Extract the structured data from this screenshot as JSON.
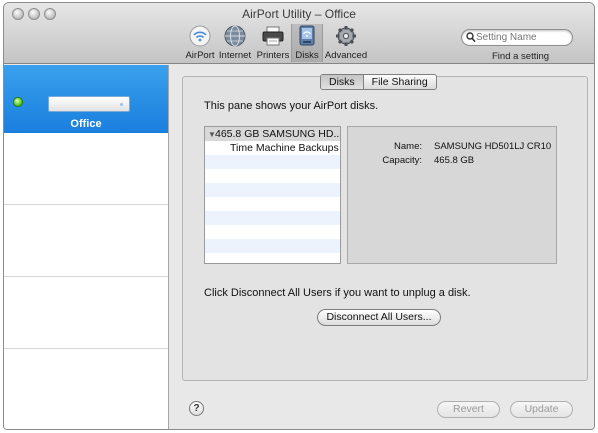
{
  "window": {
    "title": "AirPort Utility – Office"
  },
  "toolbar": {
    "items": [
      {
        "label": "AirPort",
        "icon": "airport-wifi-icon"
      },
      {
        "label": "Internet",
        "icon": "globe-icon"
      },
      {
        "label": "Printers",
        "icon": "printer-icon"
      },
      {
        "label": "Disks",
        "icon": "disk-icon",
        "selected": true
      },
      {
        "label": "Advanced",
        "icon": "gear-icon"
      }
    ],
    "search": {
      "placeholder": "Setting Name",
      "caption": "Find a setting"
    }
  },
  "sidebar": {
    "selected_base_station": {
      "name": "Office",
      "status_color": "#52c51d"
    }
  },
  "pane": {
    "tabs": [
      {
        "label": "Disks",
        "selected": true
      },
      {
        "label": "File Sharing",
        "selected": false
      }
    ],
    "intro_text": "This pane shows your AirPort disks.",
    "disk_list": {
      "disk": "465.8 GB SAMSUNG HD...",
      "partition": "Time Machine Backups"
    },
    "info": {
      "name_label": "Name:",
      "name_value": "SAMSUNG HD501LJ CR10",
      "capacity_label": "Capacity:",
      "capacity_value": "465.8 GB"
    },
    "hint_text": "Click Disconnect All Users if you want to unplug a disk.",
    "disconnect_button": "Disconnect All Users..."
  },
  "footer": {
    "help_label": "?",
    "revert_button": "Revert",
    "update_button": "Update"
  },
  "colors": {
    "selection_blue": "#1a7fde",
    "list_alternate_row": "#edf3fc"
  }
}
